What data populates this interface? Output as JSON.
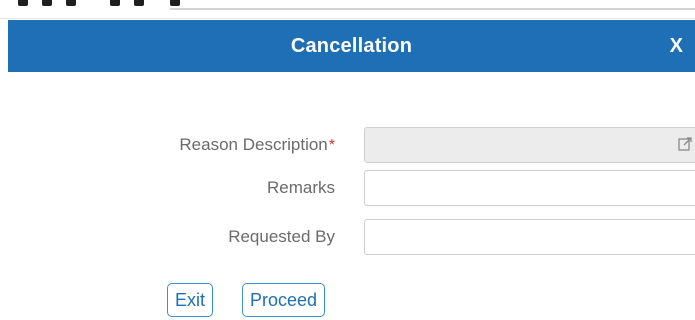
{
  "dialog": {
    "title": "Cancellation",
    "close_label": "X"
  },
  "form": {
    "reason": {
      "label": "Reason Description",
      "required_mark": "*",
      "value": "",
      "icon": "edit-external-icon"
    },
    "remarks": {
      "label": "Remarks",
      "value": ""
    },
    "requested_by": {
      "label": "Requested By",
      "value": ""
    }
  },
  "buttons": {
    "exit": "Exit",
    "proceed": "Proceed"
  },
  "colors": {
    "header_bg": "#1e6fb6",
    "button_border": "#3a8fd2",
    "required": "#d9342b"
  }
}
